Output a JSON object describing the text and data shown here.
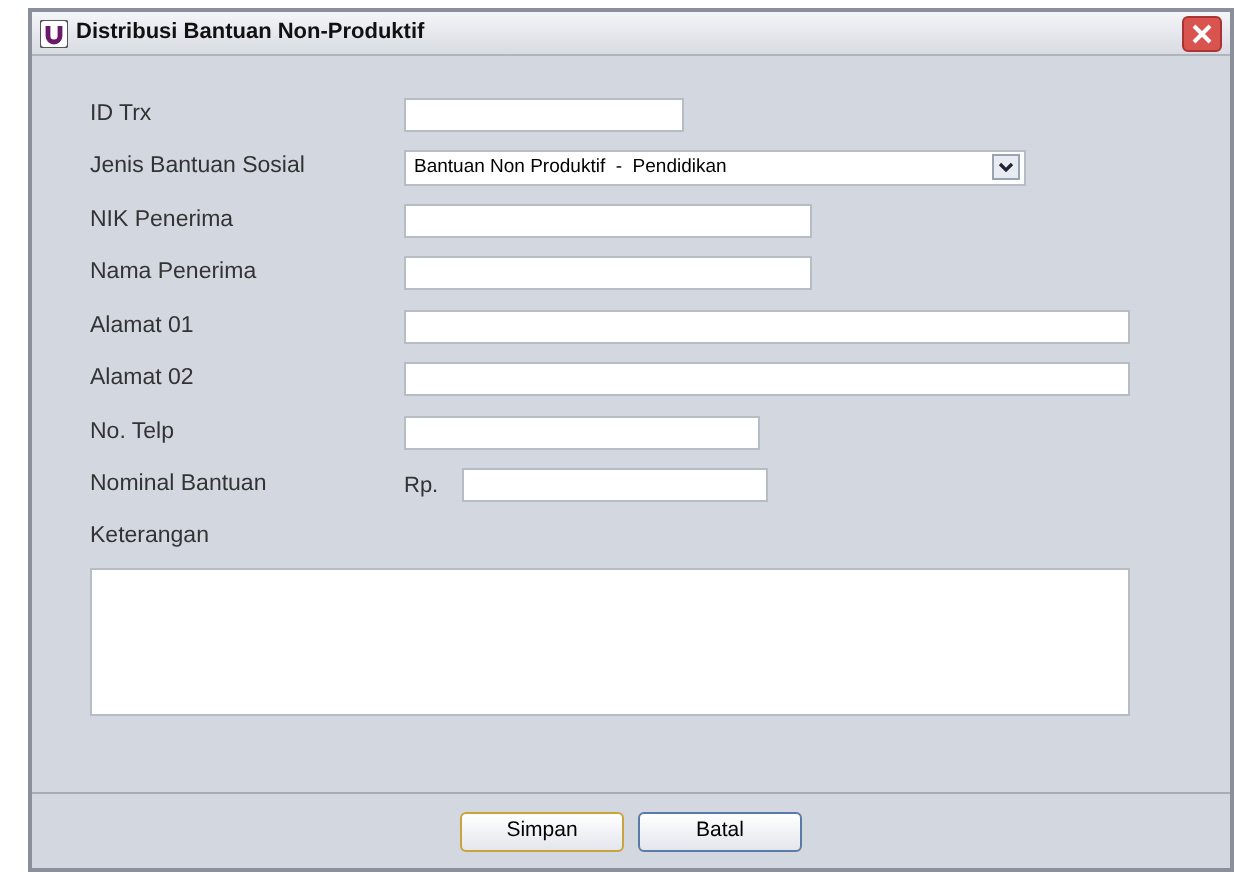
{
  "window": {
    "title": "Distribusi Bantuan Non-Produktif"
  },
  "fields": [
    {
      "label": "ID Trx",
      "kind": "text"
    },
    {
      "label": "Jenis Bantuan Sosial",
      "kind": "select",
      "value": "Bantuan Non Produktif  -  Pendidikan"
    },
    {
      "label": "NIK Penerima",
      "kind": "text"
    },
    {
      "label": "Nama Penerima",
      "kind": "text"
    },
    {
      "label": "Alamat 01",
      "kind": "text"
    },
    {
      "label": "Alamat 02",
      "kind": "text"
    },
    {
      "label": "No. Telp",
      "kind": "text"
    },
    {
      "label": "Nominal Bantuan",
      "kind": "currency",
      "prefix": "Rp."
    }
  ],
  "notes": {
    "label": "Keterangan"
  },
  "buttons": [
    {
      "label": "Simpan",
      "default": true
    },
    {
      "label": "Batal",
      "default": false
    }
  ]
}
